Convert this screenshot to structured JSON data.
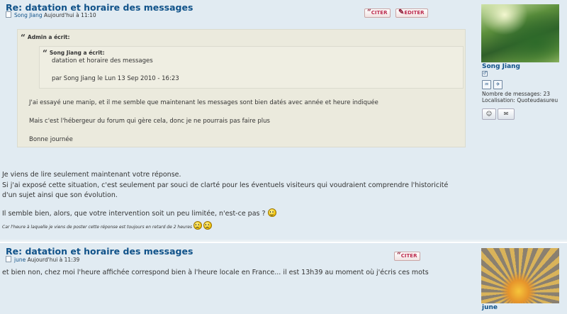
{
  "colors": {
    "title": "#105289",
    "post_bg": "#e1ebf2",
    "quote_bg": "#ebeadd",
    "button_text": "#bc2a4d"
  },
  "icons": [
    "document-icon",
    "quote-icon",
    "edit-icon",
    "smiley-icon",
    "sad-smiley-icon",
    "profile-icon",
    "pm-icon",
    "gender-icon",
    "zodiac-icon",
    "chinese-zodiac-icon"
  ],
  "post1": {
    "title": "Re: datation et horaire des messages",
    "author": "Song Jiang",
    "date": "Aujourd'hui à 11:10",
    "quote_label": "CITER",
    "edit_label": "EDITER",
    "quote_outer": {
      "cite": "Admin a écrit:",
      "inner": {
        "cite": "Song Jiang a écrit:",
        "line1": "datation et horaire des messages",
        "line2": "par Song Jiang le Lun 13 Sep 2010 - 16:23"
      },
      "p1": "J'ai essayé une manip, et il me semble que maintenant les messages sont bien datés avec année et heure indiquée",
      "p2": "Mais c'est l'hébergeur du forum qui gère cela, donc je ne pourrais pas faire plus",
      "p3": "Bonne journée"
    },
    "body": {
      "l1": "Je viens de lire seulement maintenant votre réponse.",
      "l2": "Si j'ai exposé cette situation, c'est seulement par souci de clarté pour les éventuels visiteurs qui voudraient comprendre l'historicité",
      "l3": "d'un sujet ainsi que son évolution.",
      "l4": "Il semble bien, alors, que votre intervention soit un peu limitée, n'est-ce pas ?",
      "small": "Car l'heure à laquelle je viens de poster cette réponse est toujours en retard de 2 heures"
    },
    "profile": {
      "username": "Song Jiang",
      "messages_label": "Nombre de messages:",
      "messages_count": "23",
      "location_label": "Localisation:",
      "location": "Quoteudasureu"
    }
  },
  "post2": {
    "title": "Re: datation et horaire des messages",
    "author": "june",
    "date": "Aujourd'hui à 11:39",
    "quote_label": "CITER",
    "body": "et bien non, chez moi l'heure affichée correspond bien à l'heure locale en France... il est 13h39 au moment où j'écris ces mots",
    "profile": {
      "username": "june"
    }
  }
}
